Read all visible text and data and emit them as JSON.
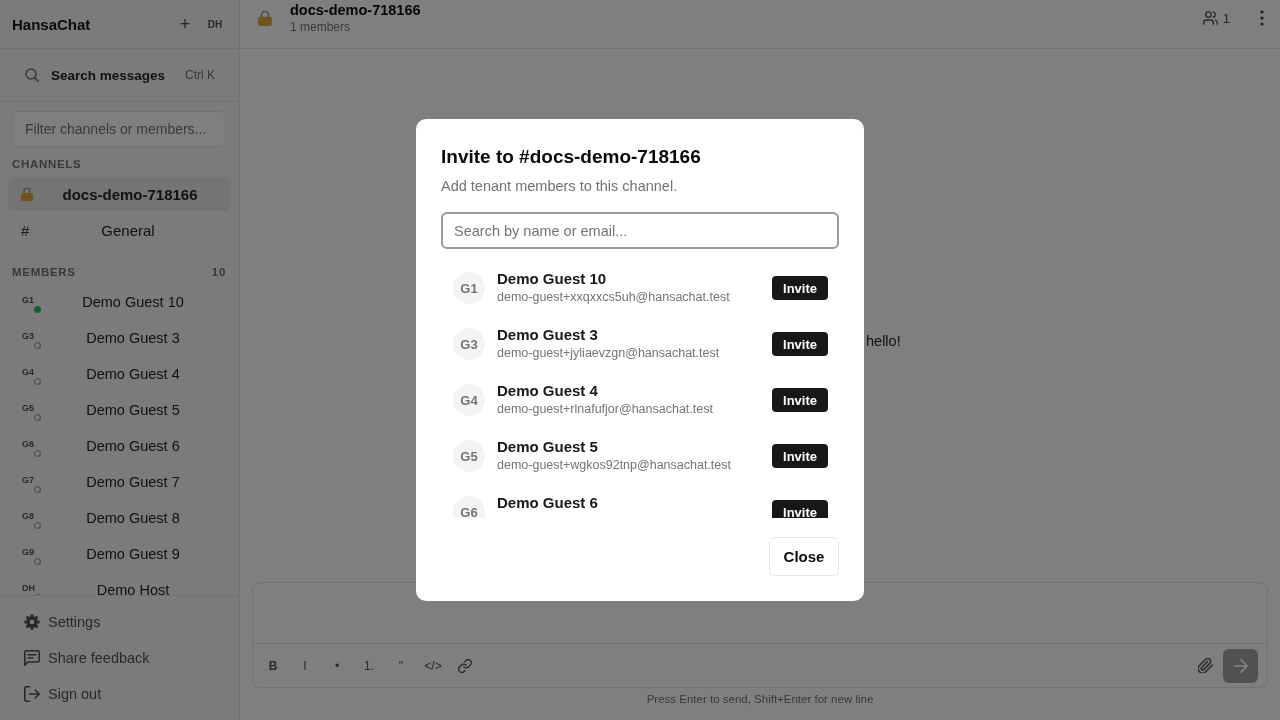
{
  "sidebar": {
    "app_name": "HansaChat",
    "add_button": "+",
    "user_initials": "DH",
    "search": {
      "label": "Search messages",
      "shortcut": "Ctrl K"
    },
    "filter": {
      "placeholder": "Filter channels or members..."
    },
    "channels": {
      "heading": "CHANNELS",
      "items": [
        {
          "kind": "private",
          "name": "docs-demo-718166",
          "selected": true
        },
        {
          "kind": "public",
          "symbol": "#",
          "name": "General",
          "selected": false
        }
      ]
    },
    "members": {
      "heading": "MEMBERS",
      "count": "10",
      "items": [
        {
          "initials": "G1",
          "name": "Demo Guest 10",
          "online": true
        },
        {
          "initials": "G3",
          "name": "Demo Guest 3",
          "online": false
        },
        {
          "initials": "G4",
          "name": "Demo Guest 4",
          "online": false
        },
        {
          "initials": "G5",
          "name": "Demo Guest 5",
          "online": false
        },
        {
          "initials": "G6",
          "name": "Demo Guest 6",
          "online": false
        },
        {
          "initials": "G7",
          "name": "Demo Guest 7",
          "online": false
        },
        {
          "initials": "G8",
          "name": "Demo Guest 8",
          "online": false
        },
        {
          "initials": "G9",
          "name": "Demo Guest 9",
          "online": false
        },
        {
          "initials": "DH",
          "name": "Demo Host",
          "online": false
        }
      ]
    },
    "footer_items": [
      {
        "kind": "settings",
        "label": "Settings"
      },
      {
        "kind": "feedback",
        "label": "Share feedback"
      },
      {
        "kind": "signout",
        "label": "Sign out"
      }
    ]
  },
  "channel_header": {
    "kind": "private",
    "title": "docs-demo-718166",
    "subtitle": "1 members",
    "member_count": "1"
  },
  "messages": [
    {
      "text": "hello!"
    }
  ],
  "composer": {
    "toolbar": [
      {
        "kind": "bold",
        "label": "B"
      },
      {
        "kind": "italic",
        "label": "I"
      },
      {
        "kind": "bullet",
        "label": "•"
      },
      {
        "kind": "ordered",
        "label": "1."
      },
      {
        "kind": "quote",
        "label": "\""
      },
      {
        "kind": "code",
        "label": "</>"
      },
      {
        "kind": "link"
      }
    ],
    "send_disabled": true,
    "hint": "Press Enter to send, Shift+Enter for new line"
  },
  "dialog": {
    "title": "Invite to #docs-demo-718166",
    "subtitle": "Add tenant members to this channel.",
    "search": {
      "placeholder": "Search by name or email...",
      "focused": true
    },
    "candidates": [
      {
        "initials": "G1",
        "name": "Demo Guest 10",
        "email": "demo-guest+xxqxxcs5uh@hansachat.test",
        "action": "Invite"
      },
      {
        "initials": "G3",
        "name": "Demo Guest 3",
        "email": "demo-guest+jyliaevzgn@hansachat.test",
        "action": "Invite"
      },
      {
        "initials": "G4",
        "name": "Demo Guest 4",
        "email": "demo-guest+rlnafufjor@hansachat.test",
        "action": "Invite"
      },
      {
        "initials": "G5",
        "name": "Demo Guest 5",
        "email": "demo-guest+wgkos92tnp@hansachat.test",
        "action": "Invite"
      },
      {
        "initials": "G6",
        "name": "Demo Guest 6",
        "action": "Invite"
      }
    ],
    "close_button": "Close"
  }
}
